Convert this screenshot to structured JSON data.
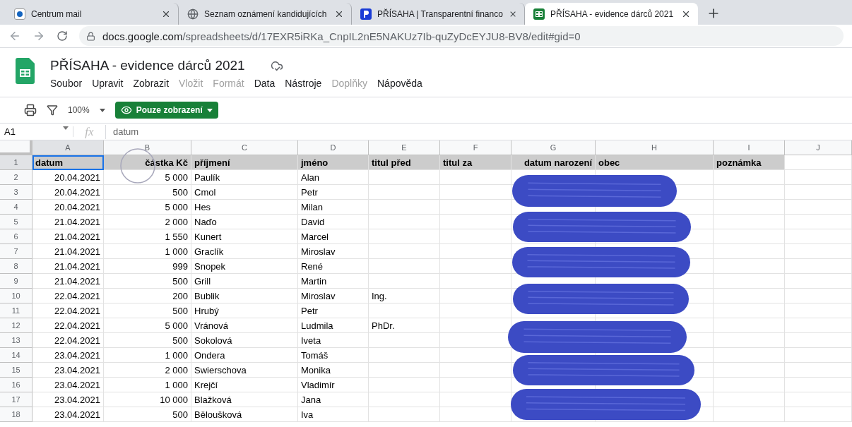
{
  "browser": {
    "tabs": [
      {
        "title": "Centrum mail",
        "kind": "mail",
        "selected": false
      },
      {
        "title": "Seznam oznámení kandidujících",
        "kind": "globe",
        "selected": false
      },
      {
        "title": "PŘÍSAHA | Transparentní financo",
        "kind": "p",
        "selected": false
      },
      {
        "title": "PŘÍSAHA - evidence dárců 2021",
        "kind": "sheets",
        "selected": true
      }
    ],
    "address": {
      "host": "docs.google.com",
      "path": "/spreadsheets/d/17EXR5iRKa_CnpIL2nE5NAKUz7Ib-quZyDcEYJU8-BV8/edit#gid=0"
    }
  },
  "document": {
    "title": "PŘÍSAHA - evidence dárců 2021",
    "menu": [
      {
        "label": "Soubor",
        "disabled": false
      },
      {
        "label": "Upravit",
        "disabled": false
      },
      {
        "label": "Zobrazit",
        "disabled": false
      },
      {
        "label": "Vložit",
        "disabled": true
      },
      {
        "label": "Formát",
        "disabled": true
      },
      {
        "label": "Data",
        "disabled": false
      },
      {
        "label": "Nástroje",
        "disabled": false
      },
      {
        "label": "Doplňky",
        "disabled": true
      },
      {
        "label": "Nápověda",
        "disabled": false
      }
    ]
  },
  "toolbar": {
    "zoom": "100%",
    "mode_button": "Pouze zobrazení"
  },
  "formula_bar": {
    "cell": "A1",
    "fx": "fx",
    "value": "datum"
  },
  "sheet": {
    "header_row_number": "1",
    "column_letters": [
      "A",
      "B",
      "C",
      "D",
      "E",
      "F",
      "G",
      "H",
      "I",
      "J"
    ],
    "header_cells": [
      {
        "text": "datum",
        "selected": true
      },
      {
        "text": "částka Kč",
        "selected": false
      },
      {
        "text": "příjmení",
        "selected": false
      },
      {
        "text": "jméno",
        "selected": false
      },
      {
        "text": "titul před",
        "selected": false
      },
      {
        "text": "titul za",
        "selected": false
      },
      {
        "text": "datum narození",
        "selected": false
      },
      {
        "text": "obec",
        "selected": false
      },
      {
        "text": "poznámka",
        "selected": false
      }
    ],
    "rows": [
      {
        "number": "2",
        "datum": "20.04.2021",
        "castka": "5 000",
        "prijmeni": "Paulík",
        "jmeno": "Alan"
      },
      {
        "number": "3",
        "datum": "20.04.2021",
        "castka": "500",
        "prijmeni": "Cmol",
        "jmeno": "Petr"
      },
      {
        "number": "4",
        "datum": "20.04.2021",
        "castka": "5 000",
        "prijmeni": "Hes",
        "jmeno": "Milan"
      },
      {
        "number": "5",
        "datum": "21.04.2021",
        "castka": "2 000",
        "prijmeni": "Naďo",
        "jmeno": "David"
      },
      {
        "number": "6",
        "datum": "21.04.2021",
        "castka": "1 550",
        "prijmeni": "Kunert",
        "jmeno": "Marcel"
      },
      {
        "number": "7",
        "datum": "21.04.2021",
        "castka": "1 000",
        "prijmeni": "Graclík",
        "jmeno": "Miroslav"
      },
      {
        "number": "8",
        "datum": "21.04.2021",
        "castka": "999",
        "prijmeni": "Snopek",
        "jmeno": "René"
      },
      {
        "number": "9",
        "datum": "21.04.2021",
        "castka": "500",
        "prijmeni": "Grill",
        "jmeno": "Martin"
      },
      {
        "number": "10",
        "datum": "22.04.2021",
        "castka": "200",
        "prijmeni": "Bublik",
        "jmeno": "Miroslav",
        "titul_pred": "Ing."
      },
      {
        "number": "11",
        "datum": "22.04.2021",
        "castka": "500",
        "prijmeni": "Hrubý",
        "jmeno": "Petr"
      },
      {
        "number": "12",
        "datum": "22.04.2021",
        "castka": "5 000",
        "prijmeni": "Vránová",
        "jmeno": "Ludmila",
        "titul_pred": "PhDr."
      },
      {
        "number": "13",
        "datum": "22.04.2021",
        "castka": "500",
        "prijmeni": "Sokolová",
        "jmeno": "Iveta"
      },
      {
        "number": "14",
        "datum": "23.04.2021",
        "castka": "1 000",
        "prijmeni": "Ondera",
        "jmeno": "Tomáš"
      },
      {
        "number": "15",
        "datum": "23.04.2021",
        "castka": "2 000",
        "prijmeni": "Swierschova",
        "jmeno": "Monika"
      },
      {
        "number": "16",
        "datum": "23.04.2021",
        "castka": "1 000",
        "prijmeni": "Krejčí",
        "jmeno": "Vladimír"
      },
      {
        "number": "17",
        "datum": "23.04.2021",
        "castka": "10 000",
        "prijmeni": "Blažková",
        "jmeno": "Jana"
      },
      {
        "number": "18",
        "datum": "23.04.2021",
        "castka": "500",
        "prijmeni": "Běloušková",
        "jmeno": "Iva"
      }
    ]
  }
}
